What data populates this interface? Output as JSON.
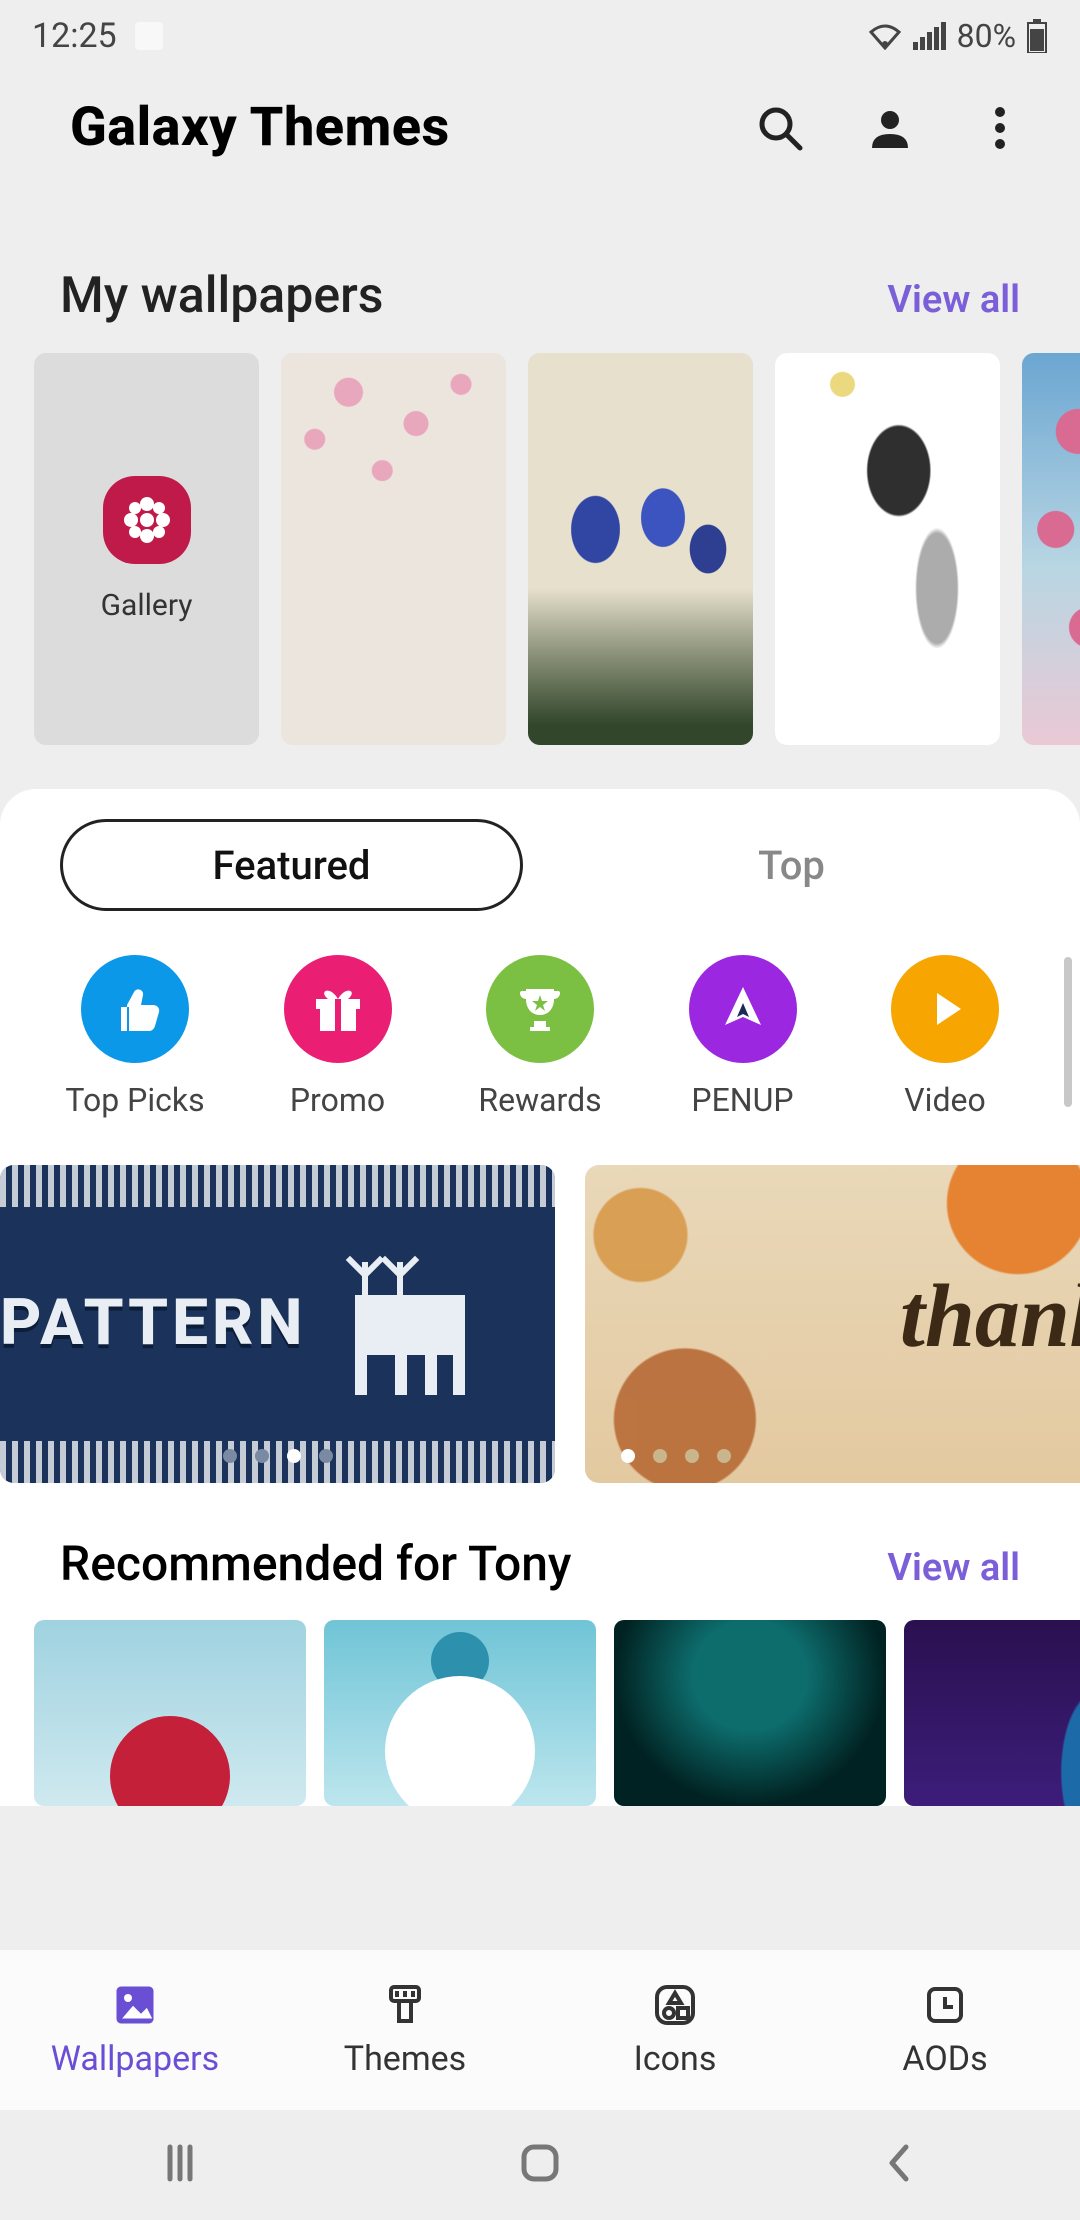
{
  "status": {
    "time": "12:25",
    "battery_pct": "80%"
  },
  "app": {
    "title": "Galaxy Themes"
  },
  "my_wallpapers": {
    "title": "My wallpapers",
    "view_all": "View all",
    "gallery_label": "Gallery"
  },
  "tabs": {
    "featured": "Featured",
    "top": "Top"
  },
  "quick": {
    "top_picks": "Top Picks",
    "promo": "Promo",
    "rewards": "Rewards",
    "penup": "PENUP",
    "video": "Video"
  },
  "banners": {
    "pattern_text": "PATTERN",
    "thanks_text": "thanks"
  },
  "recommended": {
    "title": "Recommended for Tony",
    "view_all": "View all"
  },
  "nav": {
    "wallpapers": "Wallpapers",
    "themes": "Themes",
    "icons": "Icons",
    "aods": "AODs"
  }
}
